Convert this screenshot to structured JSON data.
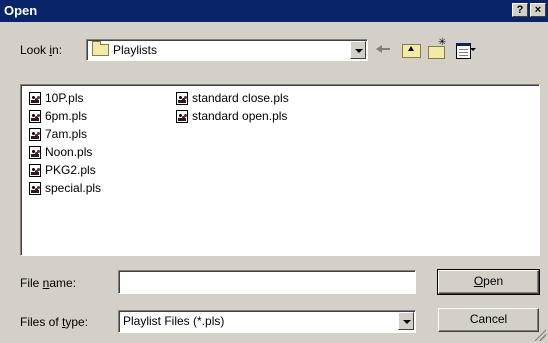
{
  "window": {
    "title": "Open",
    "help_label": "?",
    "close_label": "×"
  },
  "look_in": {
    "label_prefix": "Look ",
    "label_underlined": "i",
    "label_suffix": "n:",
    "value": "Playlists",
    "icon": "folder-icon"
  },
  "toolbar": {
    "icons": [
      "back-icon",
      "up-folder-icon",
      "new-folder-icon",
      "views-menu-icon"
    ]
  },
  "files": {
    "column1": [
      {
        "name": "10P.pls",
        "icon": "playlist-file-icon"
      },
      {
        "name": "6pm.pls",
        "icon": "playlist-file-icon"
      },
      {
        "name": "7am.pls",
        "icon": "playlist-file-icon"
      },
      {
        "name": "Noon.pls",
        "icon": "playlist-file-icon"
      },
      {
        "name": "PKG2.pls",
        "icon": "playlist-file-icon"
      },
      {
        "name": "special.pls",
        "icon": "playlist-file-icon"
      }
    ],
    "column2": [
      {
        "name": "standard close.pls",
        "icon": "playlist-file-icon"
      },
      {
        "name": "standard open.pls",
        "icon": "playlist-file-icon"
      }
    ]
  },
  "file_name": {
    "label_prefix": "File ",
    "label_underlined": "n",
    "label_suffix": "ame:",
    "value": ""
  },
  "file_type": {
    "label_prefix": "Files of ",
    "label_underlined": "t",
    "label_suffix": "ype:",
    "value": "Playlist Files (*.pls)"
  },
  "buttons": {
    "open_underlined": "O",
    "open_rest": "pen",
    "cancel": "Cancel"
  },
  "colors": {
    "titlebar": "#0a246a",
    "face": "#d4d0c8"
  }
}
